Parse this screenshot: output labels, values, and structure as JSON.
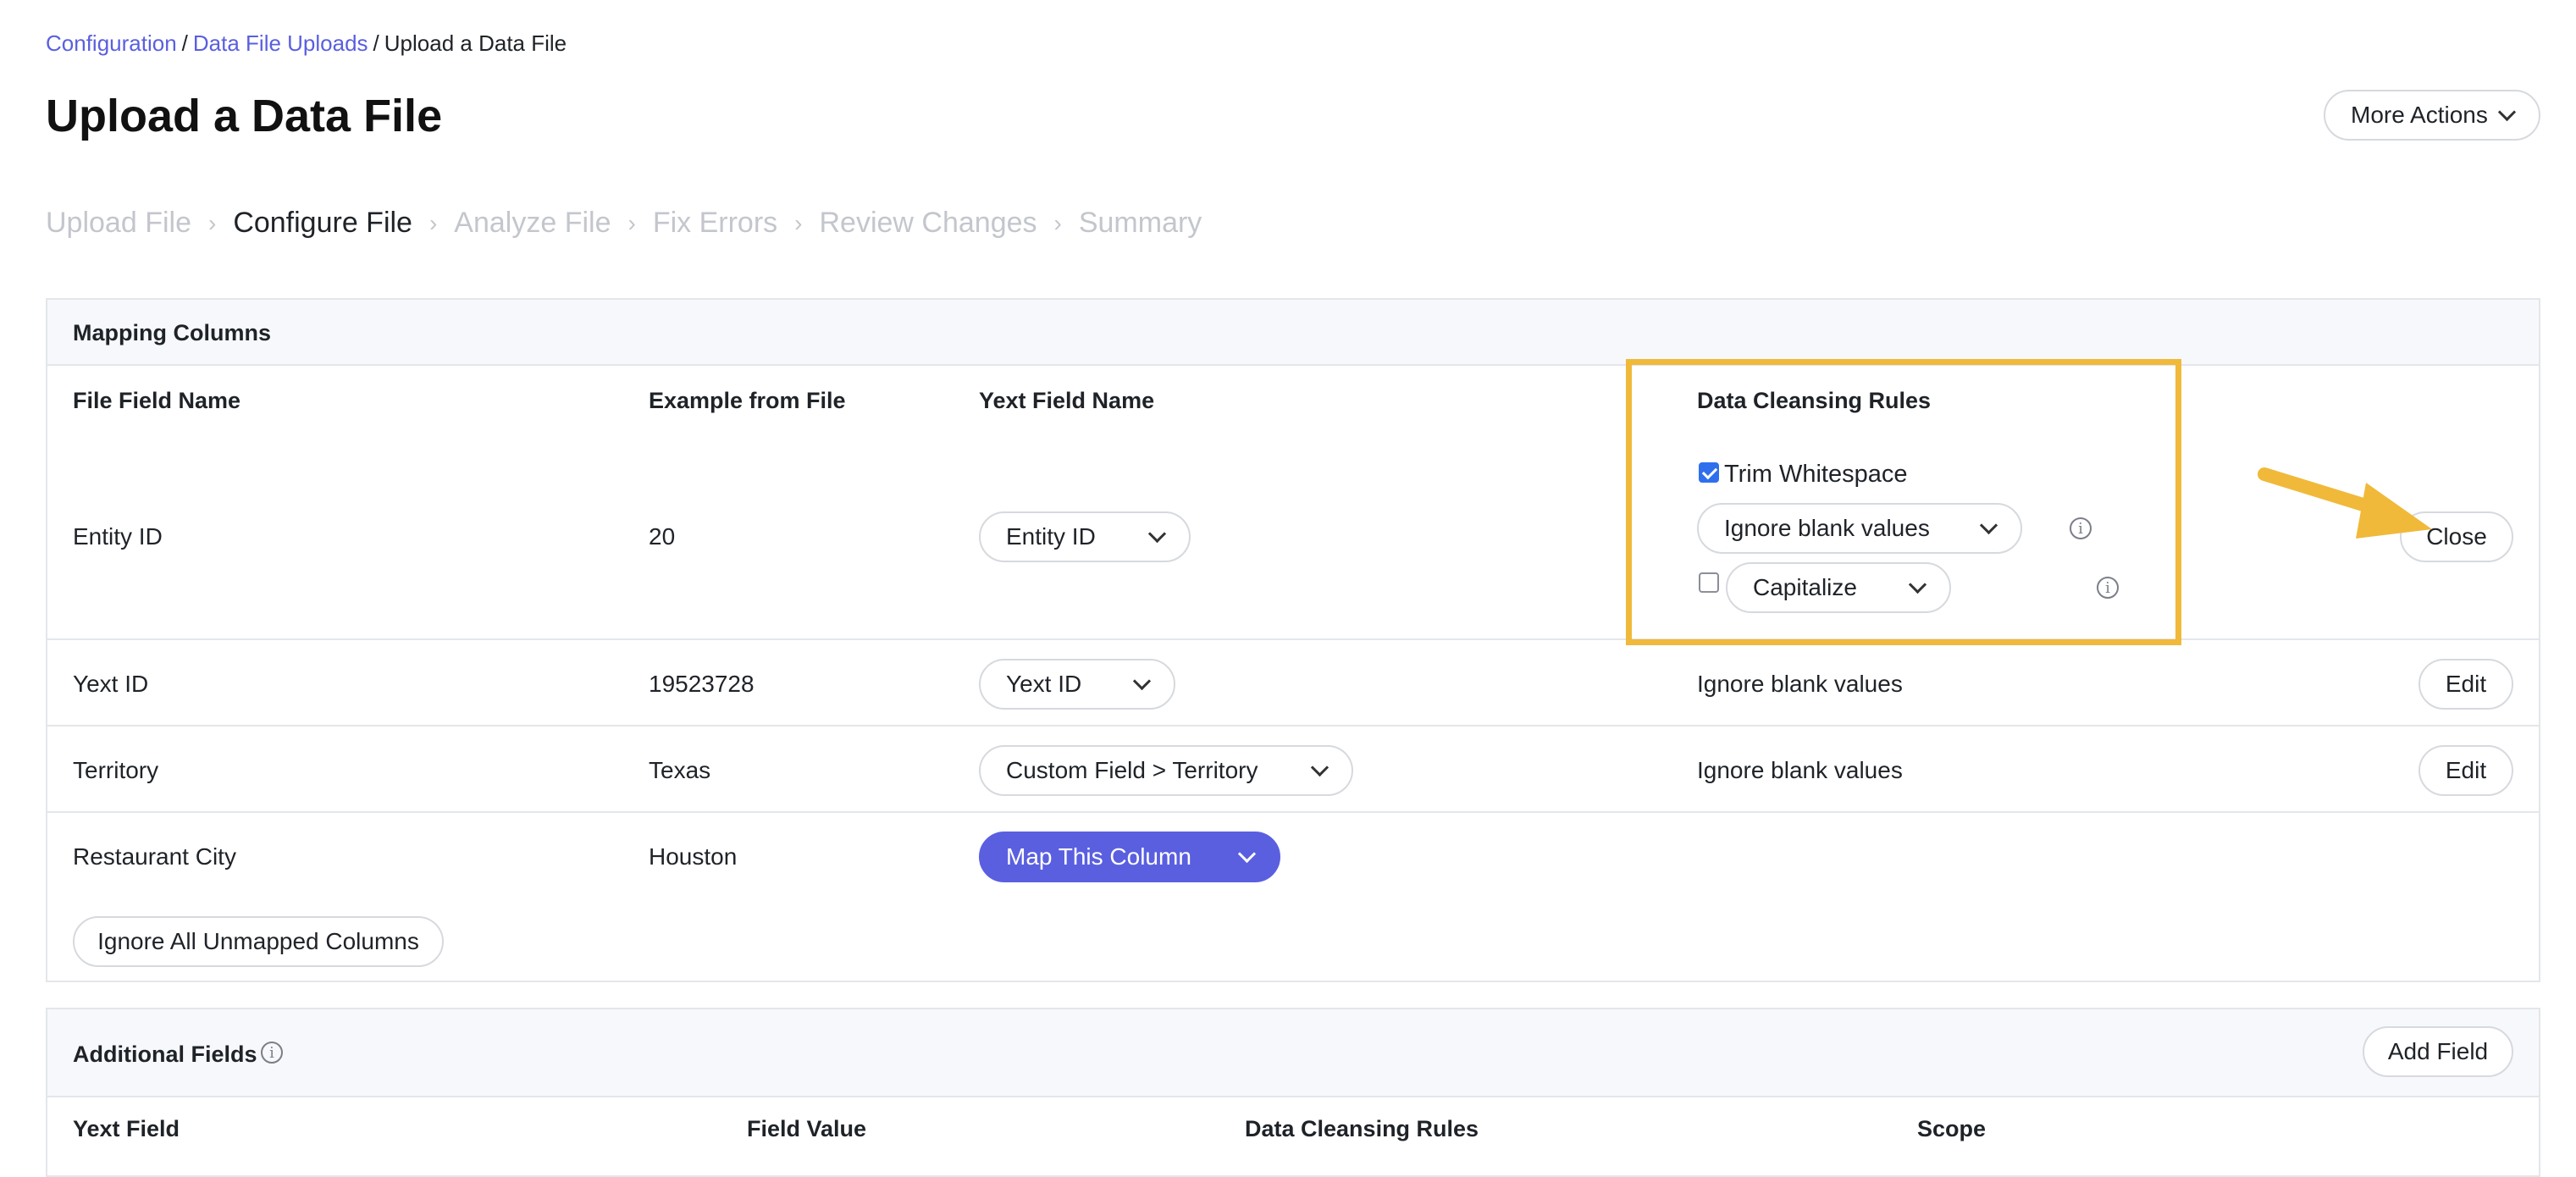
{
  "breadcrumb": {
    "items": [
      {
        "label": "Configuration"
      },
      {
        "label": "Data File Uploads"
      },
      {
        "label": "Upload a Data File"
      }
    ],
    "separator": "/"
  },
  "page": {
    "title": "Upload a Data File",
    "more_actions_label": "More Actions"
  },
  "steps": {
    "items": [
      "Upload File",
      "Configure File",
      "Analyze File",
      "Fix Errors",
      "Review Changes",
      "Summary"
    ],
    "active": "Configure File",
    "separator": "›"
  },
  "mapping": {
    "title": "Mapping Columns",
    "headers": {
      "file_field": "File Field Name",
      "example": "Example from File",
      "yext_field": "Yext Field Name",
      "rules": "Data Cleansing Rules"
    },
    "rows": [
      {
        "file_field": "Entity ID",
        "example": "20",
        "yext_field": "Entity ID",
        "rules": "",
        "action": "Close"
      },
      {
        "file_field": "Yext ID",
        "example": "19523728",
        "yext_field": "Yext ID",
        "rules": "Ignore blank values",
        "action": "Edit"
      },
      {
        "file_field": "Territory",
        "example": "Texas",
        "yext_field": "Custom Field > Territory",
        "rules": "Ignore blank values",
        "action": "Edit"
      },
      {
        "file_field": "Restaurant City",
        "example": "Houston",
        "yext_field": "Map This Column",
        "rules": "",
        "action": ""
      }
    ],
    "rules_editor": {
      "trim_label": "Trim Whitespace",
      "trim_checked": true,
      "blank_select": "Ignore blank values",
      "capitalize_checked": false,
      "capitalize_select": "Capitalize"
    },
    "ignore_all_label": "Ignore All Unmapped Columns"
  },
  "additional": {
    "title": "Additional Fields",
    "add_label": "Add Field",
    "headers": {
      "yext_field": "Yext Field",
      "value": "Field Value",
      "rules": "Data Cleansing Rules",
      "scope": "Scope"
    }
  },
  "colors": {
    "accent": "#5a5fe0",
    "highlight": "#f0b93a",
    "checkbox": "#2f6fed"
  },
  "icons": [
    "chevron-down-icon",
    "info-icon",
    "arrow-annotation-icon"
  ]
}
